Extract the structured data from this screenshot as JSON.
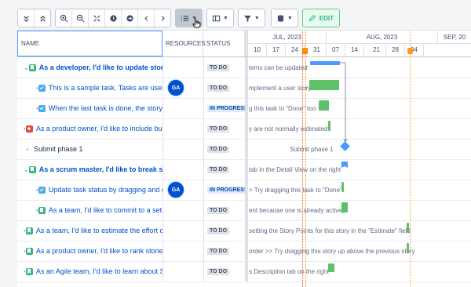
{
  "toolbar": {
    "edit_label": "EDIT"
  },
  "columns": {
    "name": "NAME",
    "resources": "RESOURCES",
    "status": "STATUS"
  },
  "timeline": {
    "months": [
      "JUL, 2023",
      "AUG, 2023",
      "SEP, 20"
    ],
    "days": [
      "10",
      "17",
      "24",
      "31",
      "07",
      "14",
      "21",
      "28",
      "04"
    ]
  },
  "rows": [
    {
      "kind": "story",
      "expander": "expanded",
      "title": "As a developer, I'd like to update story s",
      "bold": true,
      "resource": "",
      "status": "TO DO",
      "gantt_text": "tems can be updated"
    },
    {
      "kind": "task",
      "expander": "bullet",
      "title": "This is a sample task. Tasks are used t",
      "bold": false,
      "resource": "GA",
      "status": "TO DO",
      "gantt_text": "mplement a user story"
    },
    {
      "kind": "task",
      "expander": "bullet",
      "title": "When the last task is done, the story c",
      "bold": false,
      "resource": "",
      "status": "IN PROGRESS",
      "gantt_text": "g this task to \"Done\" too"
    },
    {
      "kind": "bug",
      "expander": "bullet",
      "title": "As a product owner, I'd like to include bug",
      "bold": false,
      "resource": "",
      "status": "TO DO",
      "gantt_text": "y are not normally estimated"
    },
    {
      "kind": "milestone",
      "expander": "bullet",
      "title": "Submit phase 1",
      "bold": false,
      "resource": "",
      "status": "TO DO",
      "gantt_text": "Submit phase 1"
    },
    {
      "kind": "story",
      "expander": "expanded",
      "title": "As a scrum master, I'd like to break stor",
      "bold": true,
      "resource": "",
      "status": "TO DO",
      "gantt_text": "tab in the Detail View on the right"
    },
    {
      "kind": "task",
      "expander": "bullet",
      "title": "Update task status by dragging and dr",
      "bold": false,
      "resource": "GA",
      "status": "IN PROGRESS",
      "gantt_text": "> Try dragging this task to \"Done\""
    },
    {
      "kind": "story",
      "expander": "bullet",
      "title": "As a team, I'd like to commit to a set o",
      "bold": false,
      "resource": "",
      "status": "TO DO",
      "gantt_text": "ent because one is already active)"
    },
    {
      "kind": "story",
      "expander": "bullet",
      "title": "As a team, I'd like to estimate the effort of",
      "bold": false,
      "resource": "",
      "status": "TO DO",
      "gantt_text": "setting the Story Points for this story in the \"Estimate\" field"
    },
    {
      "kind": "story",
      "expander": "bullet",
      "title": "As a product owner, I'd like to rank stories",
      "bold": false,
      "resource": "",
      "status": "TO DO",
      "gantt_text": "order >> Try dragging this story up above the previous story"
    },
    {
      "kind": "story",
      "expander": "bullet",
      "title": "As an Agile team, I'd like to learn about Sc",
      "bold": false,
      "resource": "",
      "status": "TO DO",
      "gantt_text": "s Description tab on the right"
    }
  ]
}
